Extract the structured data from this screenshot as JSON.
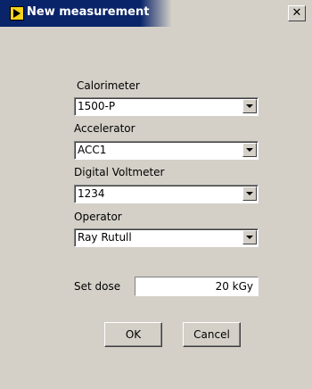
{
  "window": {
    "title": "New measurement",
    "close_glyph": "✕",
    "app_icon": "labview-run-icon",
    "accent_color": "#0a246a"
  },
  "fields": {
    "calorimeter": {
      "label": "Calorimeter",
      "value": "1500-P"
    },
    "accelerator": {
      "label": "Accelerator",
      "value": "ACC1"
    },
    "voltmeter": {
      "label": "Digital Voltmeter",
      "value": "1234"
    },
    "operator": {
      "label": "Operator",
      "value": "Ray Rutull"
    }
  },
  "dose": {
    "label": "Set dose",
    "value": "20 kGy"
  },
  "buttons": {
    "ok": "OK",
    "cancel": "Cancel"
  }
}
